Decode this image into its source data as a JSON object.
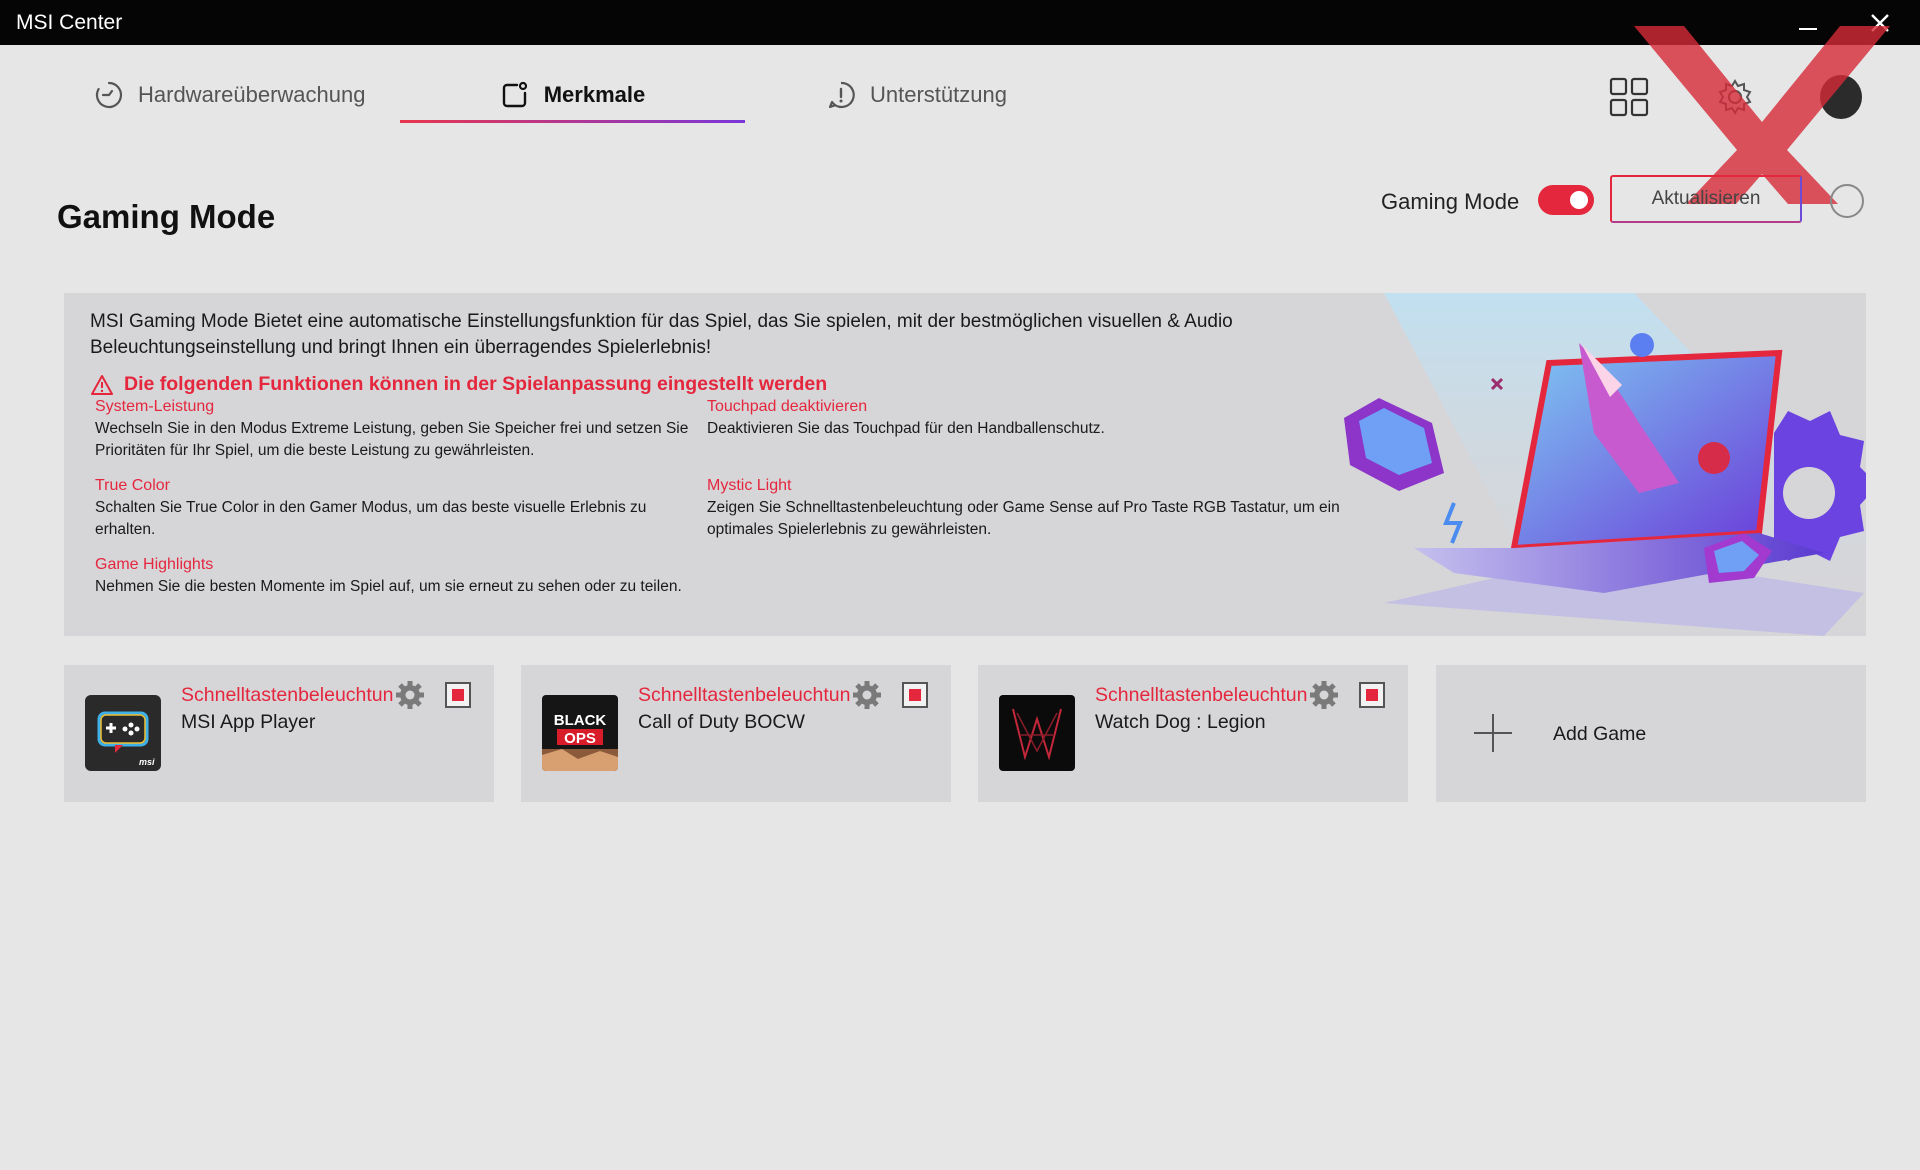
{
  "window": {
    "title": "MSI Center"
  },
  "tabs": [
    {
      "label": "Hardwareüberwachung",
      "icon": "monitor-gauge-icon",
      "active": false
    },
    {
      "label": "Merkmale",
      "icon": "features-icon",
      "active": true
    },
    {
      "label": "Unterstützung",
      "icon": "support-icon",
      "active": false
    }
  ],
  "topbar": {
    "icons": [
      "grid-icon",
      "gear-icon",
      "avatar-icon"
    ]
  },
  "header": {
    "title": "Gaming Mode",
    "toggle_label": "Gaming Mode",
    "toggle_on": true,
    "update_label": "Aktualisieren"
  },
  "banner": {
    "description": "MSI Gaming Mode Bietet eine automatische Einstellungsfunktion für das Spiel, das Sie spielen, mit der bestmöglichen visuellen & Audio Beleuchtungseinstellung und bringt Ihnen ein überragendes Spielerlebnis!",
    "warning": "Die folgenden Funktionen können in der Spielanpassung eingestellt werden",
    "features": [
      {
        "name": "System-Leistung",
        "desc": "Wechseln Sie in den Modus Extreme Leistung, geben Sie Speicher frei und setzen Sie Prioritäten für Ihr Spiel, um die beste Leistung zu gewährleisten."
      },
      {
        "name": "Touchpad deaktivieren",
        "desc": "Deaktivieren Sie das Touchpad für den Handballenschutz."
      },
      {
        "name": "True Color",
        "desc": "Schalten Sie True Color in den Gamer Modus, um das beste visuelle Erlebnis zu erhalten."
      },
      {
        "name": "Mystic Light",
        "desc": "Zeigen Sie Schnelltastenbeleuchtung oder Game Sense auf Pro Taste RGB Tastatur, um ein optimales Spielerlebnis zu gewährleisten."
      },
      {
        "name": "Game Highlights",
        "desc": "Nehmen Sie die besten Momente im Spiel auf, um sie erneut zu sehen oder zu teilen."
      }
    ]
  },
  "games": [
    {
      "profile": "Schnelltastenbeleuchtun",
      "title": "MSI App Player",
      "thumb_text": "msi"
    },
    {
      "profile": "Schnelltastenbeleuchtun",
      "title": "Call of Duty BOCW",
      "thumb_text_1": "BLACK",
      "thumb_text_2": "OPS"
    },
    {
      "profile": "Schnelltastenbeleuchtun",
      "title": "Watch Dog : Legion"
    }
  ],
  "add_game": {
    "label": "Add Game"
  },
  "colors": {
    "accent_red": "#e5273e",
    "accent_purple": "#6b4bd8",
    "titlebar": "#050505",
    "background": "#e6e6e6",
    "panel": "#d6d6d9"
  }
}
